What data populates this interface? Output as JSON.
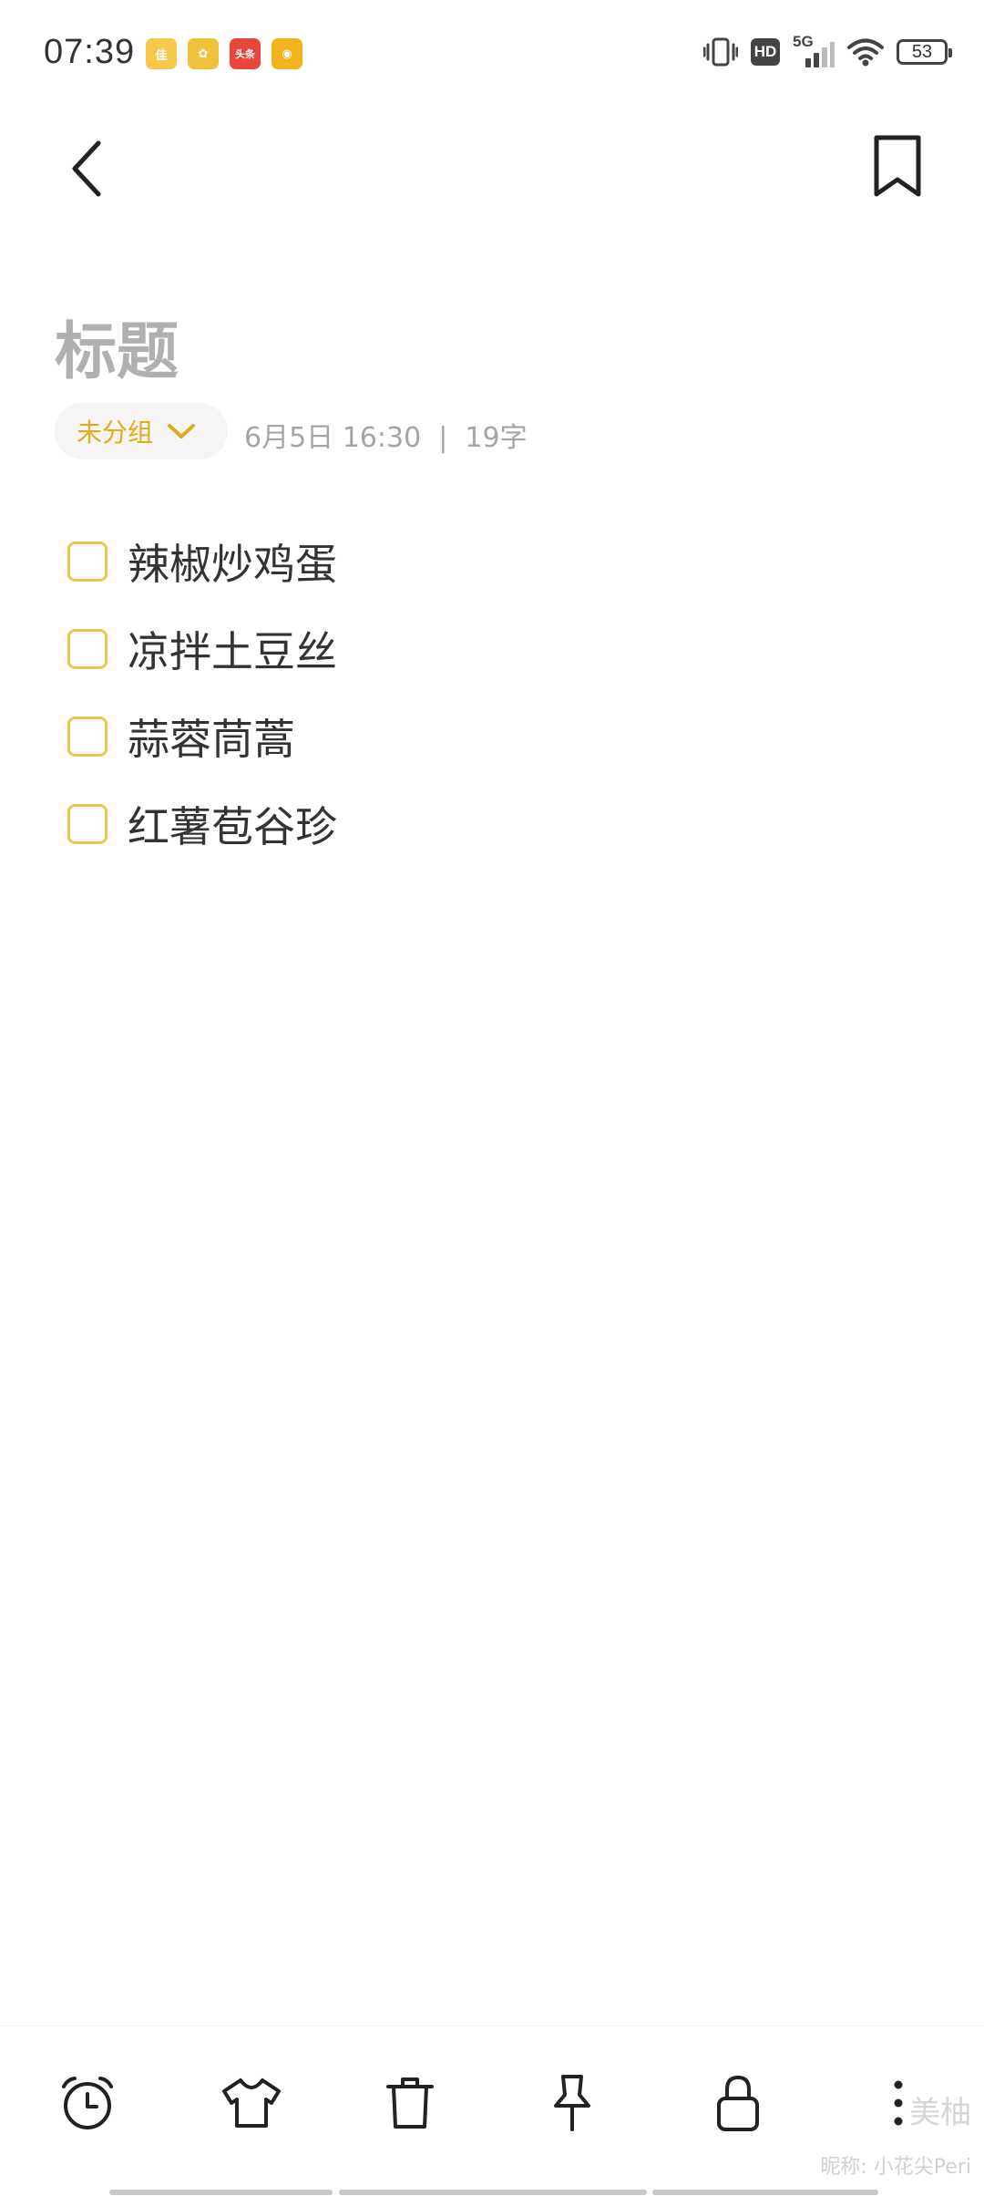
{
  "status_bar": {
    "time": "07:39",
    "notifications": [
      {
        "name": "app-icon-1",
        "label": "佳",
        "color": "#f5c84a"
      },
      {
        "name": "app-icon-2",
        "label": "✿",
        "color": "#f0c23c"
      },
      {
        "name": "app-icon-toutiao",
        "label": "头条",
        "color": "#e8453c"
      },
      {
        "name": "app-icon-weibo",
        "label": "◉",
        "color": "#f2b320"
      }
    ],
    "network": "5G",
    "hd_label": "HD",
    "battery": "53"
  },
  "note": {
    "title_placeholder": "标题",
    "group_label": "未分组",
    "meta": "6月5日 16:30  |  19字",
    "items": [
      {
        "text": "辣椒炒鸡蛋",
        "checked": false
      },
      {
        "text": "凉拌土豆丝",
        "checked": false
      },
      {
        "text": "蒜蓉茼蒿",
        "checked": false
      },
      {
        "text": "红薯苞谷珍",
        "checked": false
      }
    ]
  },
  "colors": {
    "accent": "#e5a91c",
    "checkbox": "#f0c34c",
    "title_placeholder": "#b0b0b0"
  },
  "toolbar": {
    "buttons": [
      "alarm-icon",
      "theme-shirt-icon",
      "trash-icon",
      "pin-icon",
      "lock-icon",
      "more-icon"
    ]
  },
  "watermark": {
    "logo": "美柚",
    "nickname": "昵称: 小花尖Peri"
  }
}
